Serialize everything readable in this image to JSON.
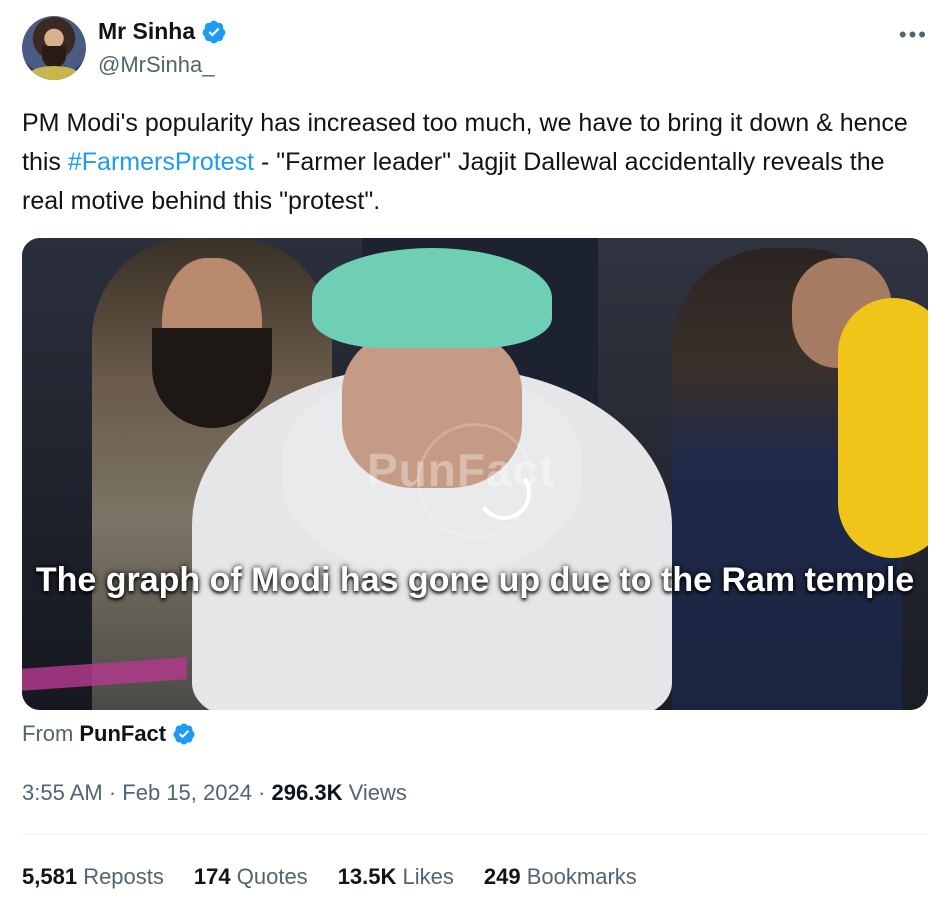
{
  "author": {
    "name": "Mr Sinha",
    "handle": "@MrSinha_"
  },
  "more_label": "•••",
  "tweet": {
    "text_before": "PM Modi's popularity has increased too much, we have to bring it down & hence this ",
    "hashtag": "#FarmersProtest",
    "text_after": " - \"Farmer leader\" Jagjit Dallewal accidentally reveals the real motive behind this \"protest\"."
  },
  "media": {
    "watermark": "PunFact",
    "caption": "The graph of Modi has gone up due to the Ram temple"
  },
  "source": {
    "prefix": "From",
    "name": "PunFact"
  },
  "meta": {
    "time": "3:55 AM",
    "separator": "·",
    "date": "Feb 15, 2024",
    "views_count": "296.3K",
    "views_label": "Views"
  },
  "stats": {
    "reposts_count": "5,581",
    "reposts_label": "Reposts",
    "quotes_count": "174",
    "quotes_label": "Quotes",
    "likes_count": "13.5K",
    "likes_label": "Likes",
    "bookmarks_count": "249",
    "bookmarks_label": "Bookmarks"
  },
  "colors": {
    "link": "#1d9bf0",
    "secondary_text": "#536471",
    "verified_badge": "#1d9bf0"
  },
  "icons": {
    "verified": "verified-badge-icon",
    "more": "more-options-icon"
  }
}
